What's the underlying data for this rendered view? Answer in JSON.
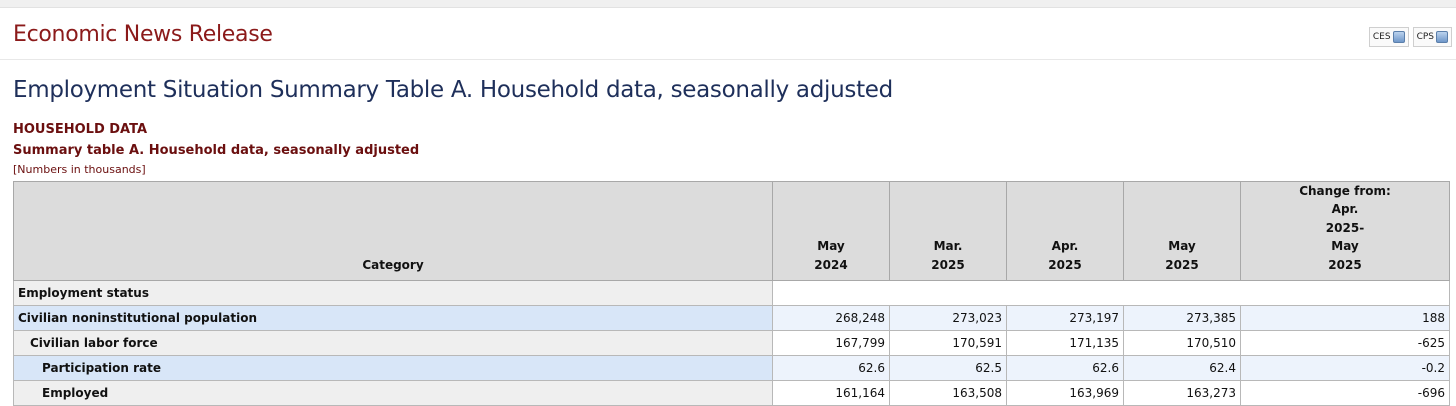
{
  "header": {
    "release_title": "Economic News Release",
    "ces_label": "CES",
    "cps_label": "CPS"
  },
  "page_title": "Employment Situation Summary Table A. Household data, seasonally adjusted",
  "table_caption": {
    "line1": "HOUSEHOLD DATA",
    "line2": "Summary table A. Household data, seasonally adjusted",
    "units": "[Numbers in thousands]"
  },
  "table": {
    "headers": {
      "category": "Category",
      "col1": [
        "May",
        "2024"
      ],
      "col2": [
        "Mar.",
        "2025"
      ],
      "col3": [
        "Apr.",
        "2025"
      ],
      "col4": [
        "May",
        "2025"
      ],
      "change": [
        "Change from:",
        "Apr.",
        "2025-",
        "May",
        "2025"
      ]
    },
    "section_label": "Employment status",
    "rows": [
      {
        "label": "Civilian noninstitutional population",
        "values": [
          "268,248",
          "273,023",
          "273,197",
          "273,385",
          "188"
        ]
      },
      {
        "label": "Civilian labor force",
        "values": [
          "167,799",
          "170,591",
          "171,135",
          "170,510",
          "-625"
        ]
      },
      {
        "label": "Participation rate",
        "values": [
          "62.6",
          "62.5",
          "62.6",
          "62.4",
          "-0.2"
        ]
      },
      {
        "label": "Employed",
        "values": [
          "161,164",
          "163,508",
          "163,969",
          "163,273",
          "-696"
        ]
      }
    ]
  },
  "colors": {
    "release_title": "#8b1a1a",
    "page_title": "#1e2f5a",
    "caption": "#6b0f0f",
    "header_bg": "#dcdcdc",
    "highlight_row": "#d8e6f8"
  },
  "icons": [
    "database-icon",
    "database-icon"
  ]
}
